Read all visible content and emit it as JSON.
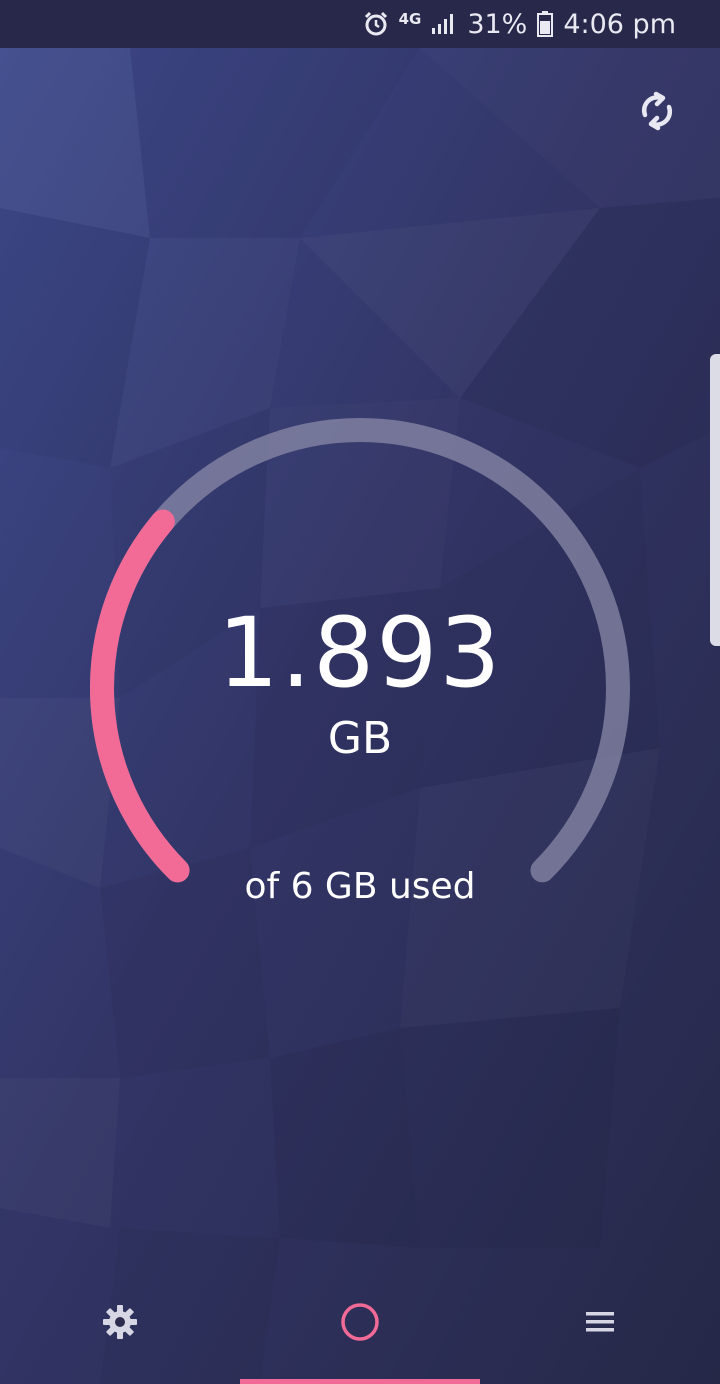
{
  "status_bar": {
    "network": "4G",
    "battery": "31%",
    "time": "4:06 pm",
    "icons": [
      "alarm-icon",
      "signal-icon",
      "battery-icon"
    ]
  },
  "header": {
    "refresh_icon": "refresh-icon"
  },
  "usage": {
    "value": "1.893",
    "unit": "GB",
    "caption": "of 6 GB used",
    "used_fraction": 0.3155
  },
  "bottom_nav": {
    "items": [
      {
        "icon": "gear-icon",
        "active": false
      },
      {
        "icon": "circle-home-icon",
        "active": true
      },
      {
        "icon": "menu-icon",
        "active": false
      }
    ]
  },
  "colors": {
    "accent": "#f26b96",
    "track": "#8a8aa8",
    "background": "#2f3058",
    "status_bar": "#27284a"
  }
}
